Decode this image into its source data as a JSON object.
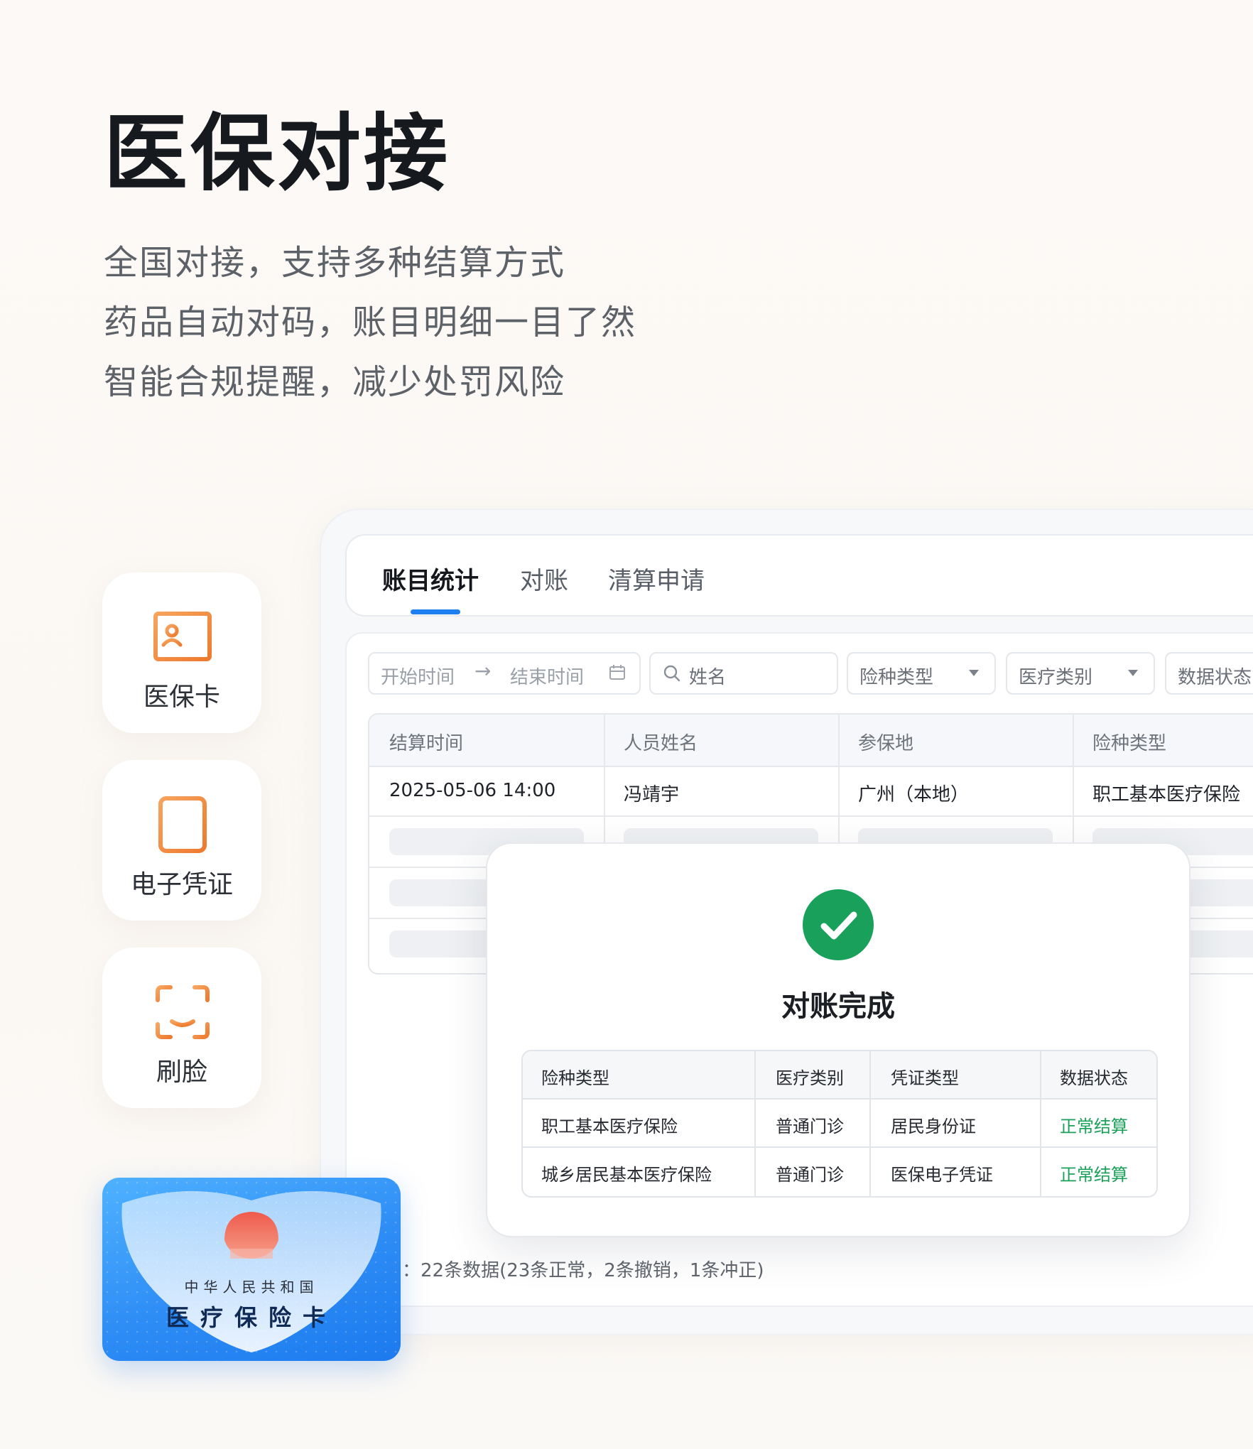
{
  "hero": {
    "title": "医保对接",
    "lines": [
      "全国对接，支持多种结算方式",
      "药品自动对码，账目明细一目了然",
      "智能合规提醒，减少处罚风险"
    ]
  },
  "features": [
    {
      "label": "医保卡",
      "icon": "id-card-icon"
    },
    {
      "label": "电子凭证",
      "icon": "document-icon"
    },
    {
      "label": "刷脸",
      "icon": "face-scan-icon"
    }
  ],
  "tabs": [
    {
      "label": "账目统计",
      "active": true
    },
    {
      "label": "对账",
      "active": false
    },
    {
      "label": "清算申请",
      "active": false
    }
  ],
  "filters": {
    "start_placeholder": "开始时间",
    "end_placeholder": "结束时间",
    "name_placeholder": "姓名",
    "insurance_type": "险种类型",
    "medical_type": "医疗类别",
    "data_status": "数据状态"
  },
  "grid": {
    "headers": [
      "结算时间",
      "人员姓名",
      "参保地",
      "险种类型"
    ],
    "rows": [
      [
        "2025-05-06 14:00",
        "冯靖宇",
        "广州（本地）",
        "职工基本医疗保险"
      ]
    ]
  },
  "footer": {
    "stat": "：22条数据(23条正常，2条撤销，1条冲正)"
  },
  "modal": {
    "title": "对账完成",
    "headers": [
      "险种类型",
      "医疗类别",
      "凭证类型",
      "数据状态"
    ],
    "rows": [
      [
        "职工基本医疗保险",
        "普通门诊",
        "居民身份证",
        "正常结算"
      ],
      [
        "城乡居民基本医疗保险",
        "普通门诊",
        "医保电子凭证",
        "正常结算"
      ]
    ]
  },
  "insurance_card": {
    "line1": "中华人民共和国",
    "line2": "医疗保险卡"
  },
  "colors": {
    "accent": "#1e7ff0",
    "orange_icon": "#f08a3a",
    "success": "#19a05a"
  }
}
